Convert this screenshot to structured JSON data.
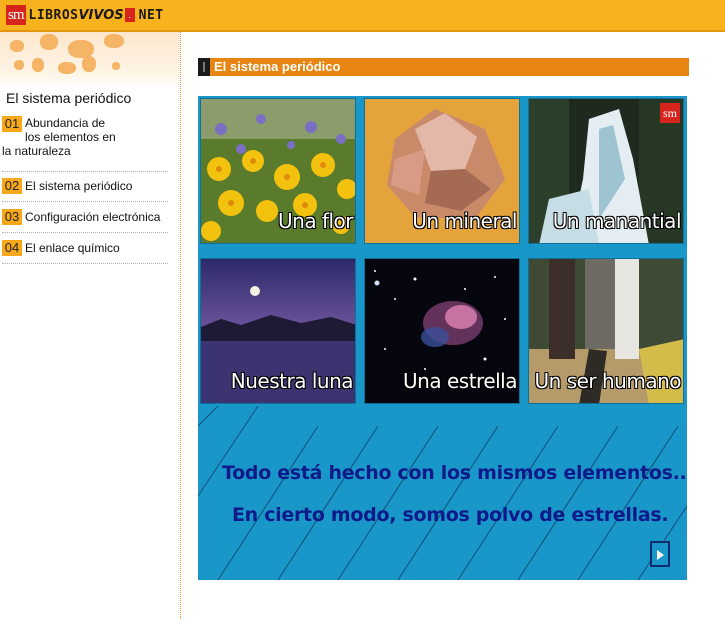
{
  "header": {
    "logo_sm": "sm",
    "logo_libros": "LIBROS",
    "logo_vivos": "VIVOS",
    "logo_net": "NET",
    "logo_dot": "."
  },
  "sidebar": {
    "title": "El sistema periódico",
    "items": [
      {
        "num": "01",
        "label": "Abundancia de los elementos en la naturaleza"
      },
      {
        "num": "02",
        "label": "El sistema periódico"
      },
      {
        "num": "03",
        "label": "Configuración electrónica"
      },
      {
        "num": "04",
        "label": "El enlace químico"
      }
    ]
  },
  "section": {
    "title": "El sistema periódico"
  },
  "tiles": [
    {
      "label": "Una flor"
    },
    {
      "label": "Un mineral"
    },
    {
      "label": "Un manantial",
      "badge": "sm"
    },
    {
      "label": "Nuestra luna"
    },
    {
      "label": "Una estrella"
    },
    {
      "label": "Un ser humano"
    }
  ],
  "quote": {
    "line1": "Todo está hecho con los mismos elementos...",
    "line2": "En cierto modo, somos polvo de estrellas."
  },
  "colors": {
    "header": "#f7b21e",
    "section_bar": "#e88410",
    "panel": "#1997c9",
    "quote_text": "#0f1a8a",
    "menu_num": "#f7a81b"
  }
}
